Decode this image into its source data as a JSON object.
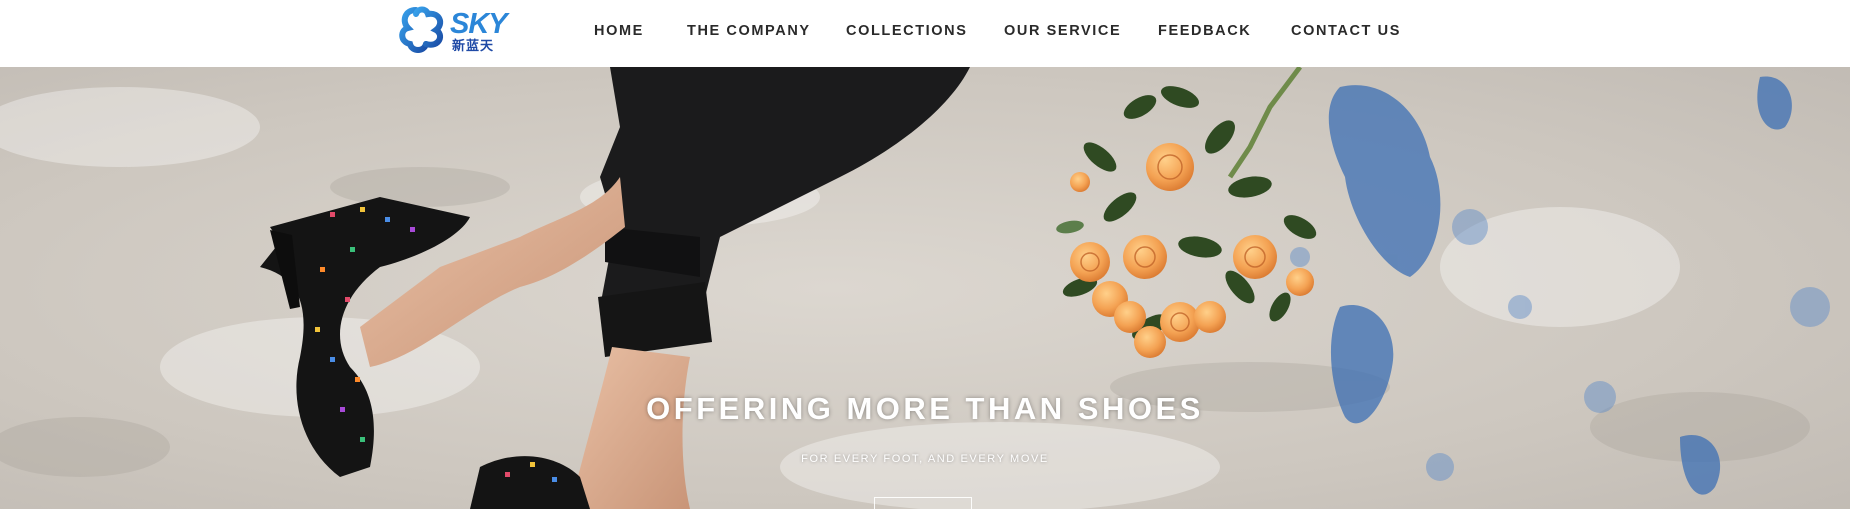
{
  "brand": {
    "logo_text": "SKY",
    "logo_subtext": "新蓝天",
    "colors": {
      "primary": "#2b86d8",
      "secondary": "#1f4aa6"
    }
  },
  "nav": {
    "items": [
      {
        "label": "HOME"
      },
      {
        "label": "THE COMPANY"
      },
      {
        "label": "COLLECTIONS"
      },
      {
        "label": "OUR SERVICE"
      },
      {
        "label": "FEEDBACK"
      },
      {
        "label": "CONTACT US"
      }
    ]
  },
  "hero": {
    "title": "OFFERING MORE THAN SHOES",
    "subtitle": "FOR EVERY FOOT, AND EVERY MOVE",
    "image_description_icon": "hero-photo"
  }
}
